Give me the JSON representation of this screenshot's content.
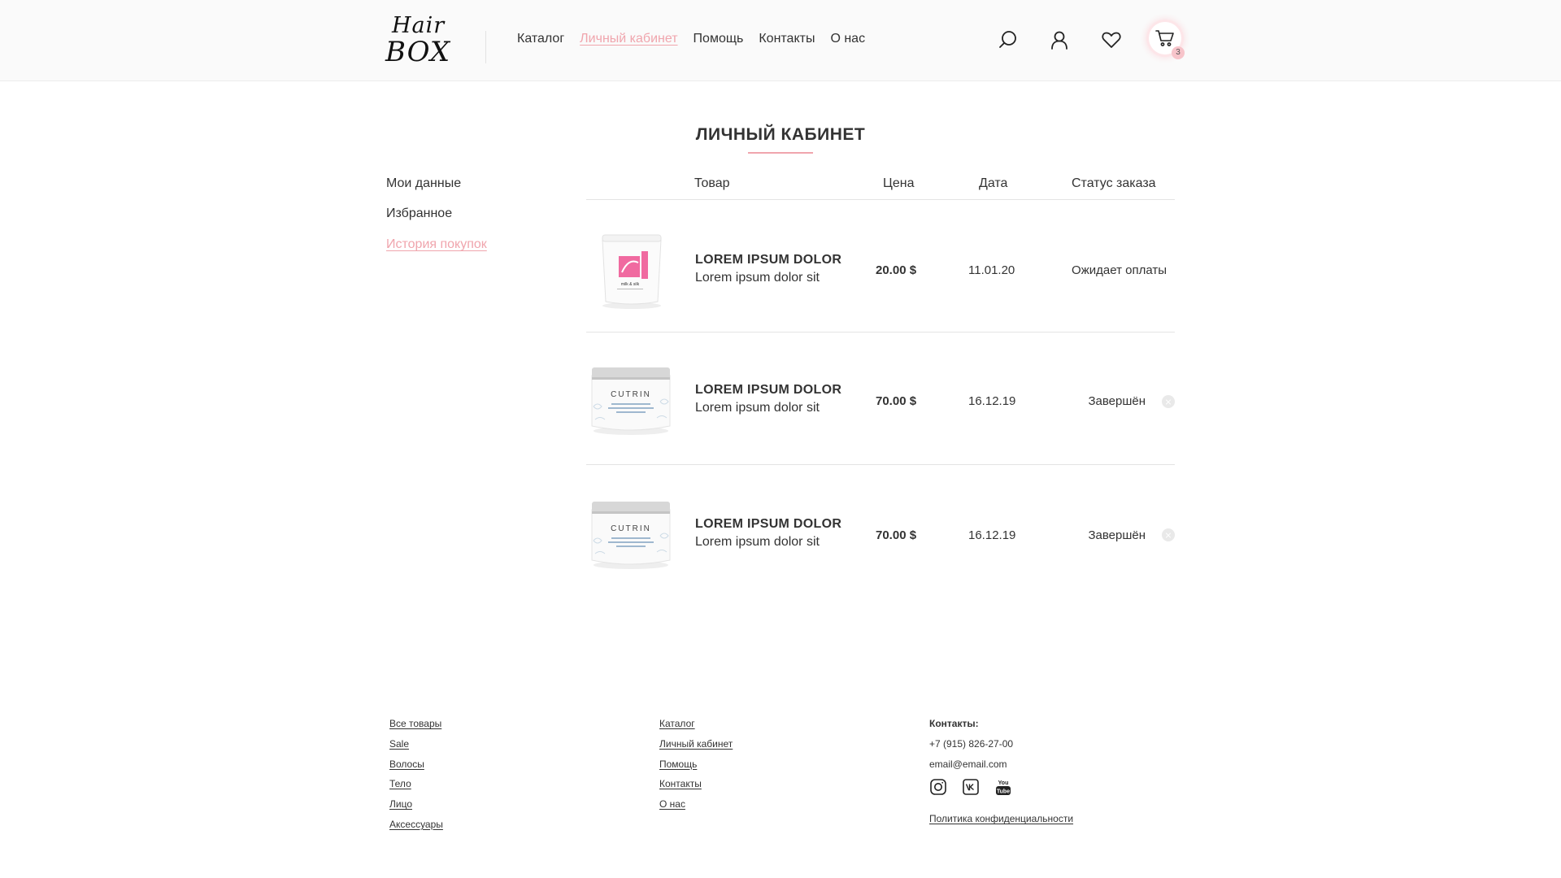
{
  "header": {
    "logo_top": "Hair",
    "logo_bottom": "BOX",
    "nav": [
      "Каталог",
      "Личный кабинет",
      "Помощь",
      "Контакты",
      "О нас"
    ],
    "active_nav": "Личный кабинет",
    "cart_count": "3",
    "icons": [
      "search-icon",
      "user-icon",
      "heart-icon",
      "cart-icon"
    ],
    "accent_color": "#f0a5ad"
  },
  "page": {
    "title": "ЛИЧНЫЙ КАБИНЕТ"
  },
  "sidebar": {
    "items": [
      "Мои данные",
      "Избранное",
      "История покупок"
    ],
    "active": "История покупок"
  },
  "table": {
    "headers": [
      "Товар",
      "Цена",
      "Дата",
      "Статус заказа"
    ],
    "rows": [
      {
        "name": "LOREM IPSUM DOLOR",
        "desc": "Lorem ipsum dolor sit",
        "price": "20.00 $",
        "date": "11.01.20",
        "status": "Ожидает оплаты",
        "thumb_brand": "milk & silk"
      },
      {
        "name": "LOREM IPSUM DOLOR",
        "desc": "Lorem ipsum dolor sit",
        "price": "70.00 $",
        "date": "16.12.19",
        "status": "Завершён",
        "thumb_brand": "CUTRIN"
      },
      {
        "name": "LOREM IPSUM DOLOR",
        "desc": "Lorem ipsum dolor sit",
        "price": "70.00 $",
        "date": "16.12.19",
        "status": "Завершён",
        "thumb_brand": "CUTRIN"
      }
    ]
  },
  "footer": {
    "col1": [
      "Все товары",
      "Sale",
      "Волосы",
      "Тело",
      "Лицо",
      "Аксессуары"
    ],
    "col2": [
      "Каталог",
      "Личный кабинет",
      "Помощь",
      "Контакты",
      "О нас"
    ],
    "contacts_title": "Контакты:",
    "phone": "+7 (915) 826-27-00",
    "email": "email@email.com",
    "socials": [
      "instagram-icon",
      "vk-icon",
      "youtube-icon"
    ],
    "policy": "Политика конфиденциальности"
  }
}
